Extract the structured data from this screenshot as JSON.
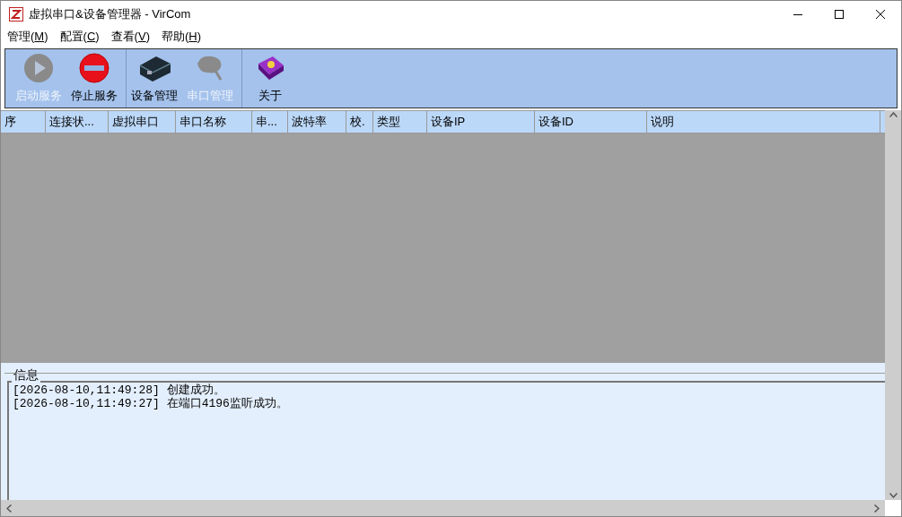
{
  "window": {
    "title": "虚拟串口&设备管理器 - VirCom"
  },
  "menu": [
    {
      "before": "管理(",
      "key": "M",
      "after": ")"
    },
    {
      "before": "配置(",
      "key": "C",
      "after": ")"
    },
    {
      "before": "查看(",
      "key": "V",
      "after": ")"
    },
    {
      "before": "帮助(",
      "key": "H",
      "after": ")"
    }
  ],
  "toolbar": [
    [
      {
        "kind": "play",
        "label": "启动服务",
        "disabled": true
      },
      {
        "kind": "stop",
        "label": "停止服务",
        "disabled": false
      }
    ],
    [
      {
        "kind": "device",
        "label": "设备管理",
        "disabled": false
      },
      {
        "kind": "plug",
        "label": "串口管理",
        "disabled": true
      }
    ],
    [
      {
        "kind": "book",
        "label": "关于",
        "disabled": false
      }
    ]
  ],
  "table": {
    "columns": [
      "序",
      "连接状...",
      "虚拟串口",
      "串口名称",
      "串...",
      "波特率",
      "校.",
      "类型",
      "设备IP",
      "设备ID",
      "说明"
    ]
  },
  "info": {
    "title": "信息",
    "lines": [
      "[2026-08-10,11:49:28] 创建成功。",
      "[2026-08-10,11:49:27] 在端口4196监听成功。"
    ]
  }
}
